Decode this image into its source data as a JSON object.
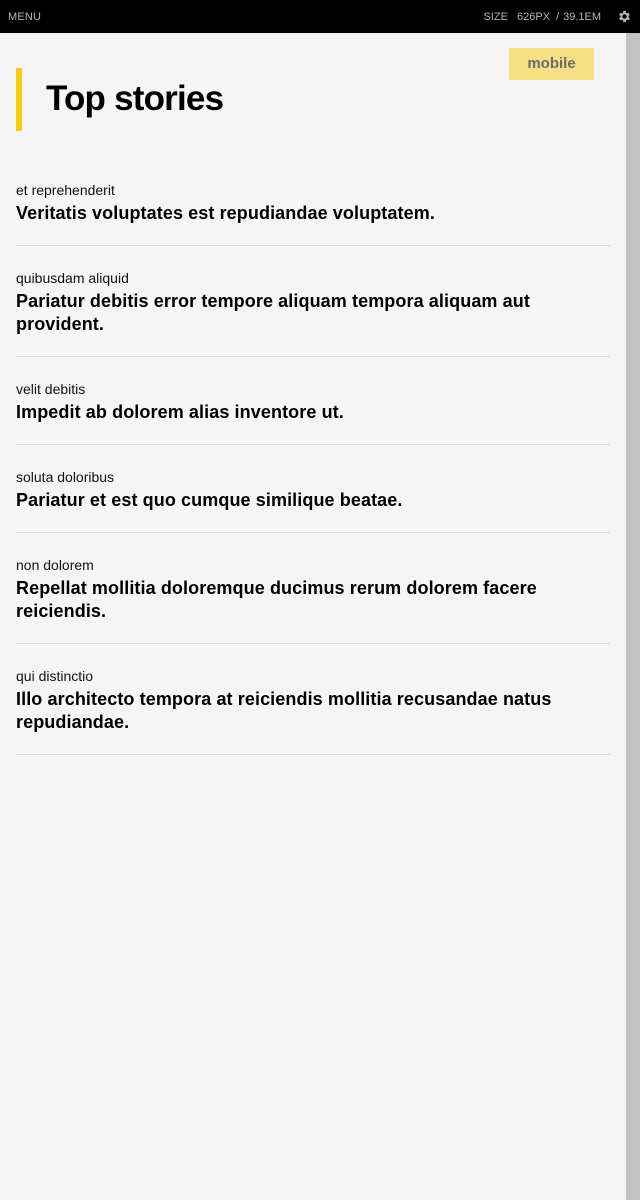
{
  "topbar": {
    "menu_label": "MENU",
    "size_label": "SIZE",
    "size_px": "626PX",
    "size_separator": "/",
    "size_em": "39.1EM",
    "settings_icon": "gear-icon"
  },
  "page": {
    "badge": "mobile",
    "heading": "Top stories",
    "accent_color": "#fcc917",
    "badge_color": "#f6df85"
  },
  "stories": [
    {
      "kicker": "et reprehenderit",
      "title": "Veritatis voluptates est repudiandae voluptatem."
    },
    {
      "kicker": "quibusdam aliquid",
      "title": "Pariatur debitis error tempore aliquam tempora aliquam aut provident."
    },
    {
      "kicker": "velit debitis",
      "title": "Impedit ab dolorem alias inventore ut."
    },
    {
      "kicker": "soluta doloribus",
      "title": "Pariatur et est quo cumque similique beatae."
    },
    {
      "kicker": "non dolorem",
      "title": "Repellat mollitia doloremque ducimus rerum dolorem facere reiciendis."
    },
    {
      "kicker": "qui distinctio",
      "title": "Illo architecto tempora at reiciendis mollitia recusandae natus repudiandae."
    }
  ]
}
